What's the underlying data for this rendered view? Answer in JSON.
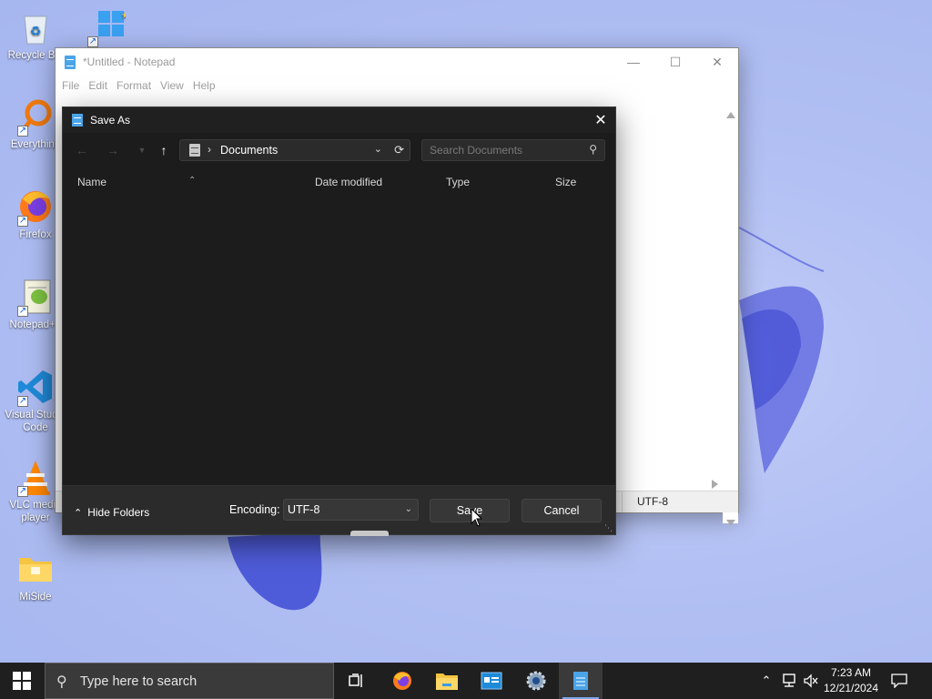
{
  "desktop": {
    "icons": [
      {
        "label": "Recycle Bin",
        "icon": "recycle-bin-icon"
      },
      {
        "label": "Everything",
        "icon": "everything-search-icon"
      },
      {
        "label": "Firefox",
        "icon": "firefox-icon"
      },
      {
        "label": "Notepad++",
        "icon": "notepad-plus-plus-icon"
      },
      {
        "label": "Visual Studio Code",
        "icon": "vscode-icon"
      },
      {
        "label": "VLC media player",
        "icon": "vlc-icon"
      },
      {
        "label": "MiSide",
        "icon": "folder-icon"
      }
    ]
  },
  "notepad": {
    "title": "*Untitled - Notepad",
    "menu": [
      "File",
      "Edit",
      "Format",
      "View",
      "Help"
    ],
    "status_encoding": "UTF-8"
  },
  "dialog": {
    "title": "Save As",
    "location": "Documents",
    "search_placeholder": "Search Documents",
    "columns": [
      "Name",
      "Date modified",
      "Type",
      "Size"
    ],
    "hide_folders": "Hide Folders",
    "encoding_label": "Encoding:",
    "encoding_value": "UTF-8",
    "save_label": "Save",
    "cancel_label": "Cancel"
  },
  "taskbar": {
    "search_placeholder": "Type here to search",
    "apps": [
      "task-view-icon",
      "firefox-icon",
      "file-explorer-icon",
      "control-panel-icon",
      "settings-icon",
      "notepad-icon"
    ],
    "time": "7:23 AM",
    "date": "12/21/2024"
  },
  "colors": {
    "dialog_bg": "#1c1c1c",
    "footer_bg": "#2b2b2b",
    "taskbar_bg": "#1f1f1f",
    "wallpaper": "#a9b8f0",
    "accent": "#4aa4e8"
  }
}
